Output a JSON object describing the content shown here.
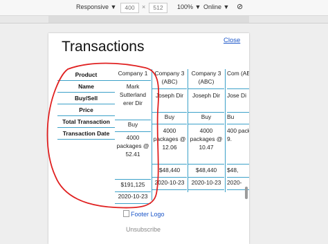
{
  "devtools": {
    "mode": "Responsive",
    "width": "400",
    "height": "512",
    "zoom": "100%",
    "network": "Online"
  },
  "email": {
    "title": "Transactions",
    "close_label": "Close",
    "row_labels": [
      "Product",
      "Name",
      "Buy/Sell",
      "Price",
      "Total Transaction",
      "Transaction Date"
    ],
    "columns": [
      {
        "product": "Company 1",
        "name": "Mark Sutterland erer Dir",
        "buy_sell": "Buy",
        "price": "4000 packages @ 52.41",
        "total": "$191,125",
        "date": "2020-10-23"
      },
      {
        "product": "Company 3 (ABC)",
        "name": "Joseph Dir",
        "buy_sell": "Buy",
        "price": "4000 packages @ 12.06",
        "total": "$48,440",
        "date": "2020-10-23"
      },
      {
        "product": "Company 3 (ABC)",
        "name": "Joseph Dir",
        "buy_sell": "Buy",
        "price": "4000 packages @ 10.47",
        "total": "$48,440",
        "date": "2020-10-23"
      },
      {
        "product": "Com (AB",
        "name": "Jose Di",
        "buy_sell": "Bu",
        "price": "400 pack @ 9.",
        "total": "$48,",
        "date": "2020-"
      }
    ],
    "footer_logo_alt": "Footer Logo",
    "unsubscribe": "Unsubscribe"
  },
  "colors": {
    "table_border": "#3aa0c8",
    "annotation": "#e02020",
    "link": "#1a55c8"
  }
}
